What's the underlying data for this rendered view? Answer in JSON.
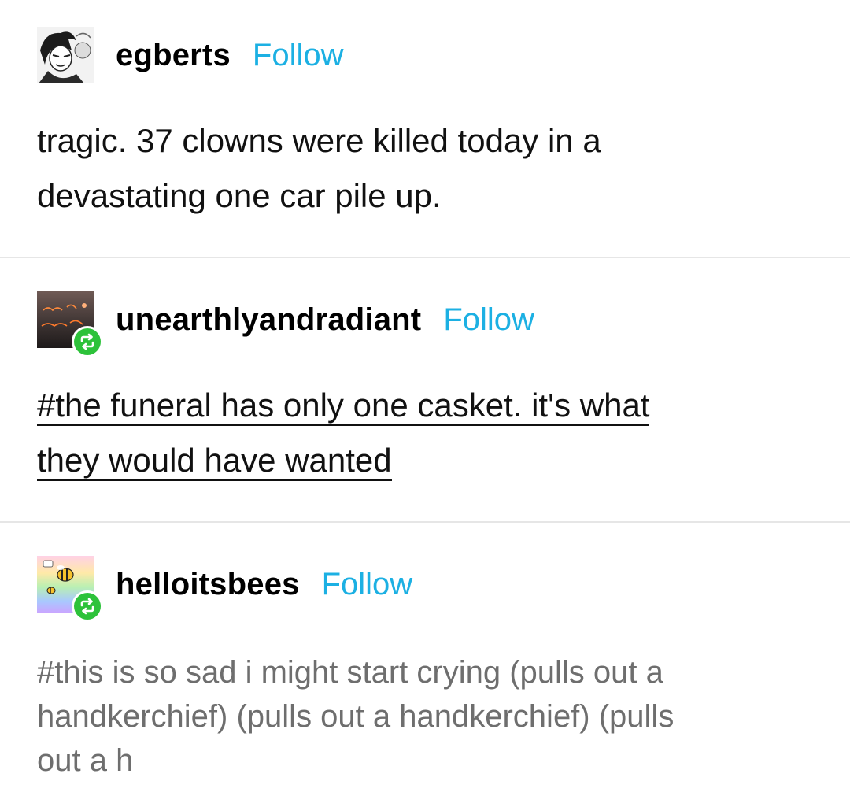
{
  "posts": [
    {
      "username": "egberts",
      "follow_label": "Follow",
      "avatar": "manga-character-avatar",
      "reblogged": false,
      "lines": [
        "tragic. 37 clowns were killed today in a",
        "devastating one car pile up."
      ]
    },
    {
      "username": "unearthlyandradiant",
      "follow_label": "Follow",
      "avatar": "neon-sign-avatar",
      "reblogged": true,
      "lines": [
        "#the funeral has only one casket. it's what",
        "they would have wanted"
      ]
    },
    {
      "username": "helloitsbees",
      "follow_label": "Follow",
      "avatar": "bee-rainbow-avatar",
      "reblogged": true,
      "lines": [
        "#this is so sad i might start crying (pulls out a",
        "handkerchief) (pulls out a handkerchief) (pulls",
        "out a h"
      ]
    }
  ],
  "colors": {
    "follow": "#1cb0e3",
    "reblog_badge": "#2dc23a",
    "divider": "#e6e6e6",
    "tag_text": "#6e6e6e"
  },
  "icons": {
    "reblog": "reblog-icon"
  }
}
